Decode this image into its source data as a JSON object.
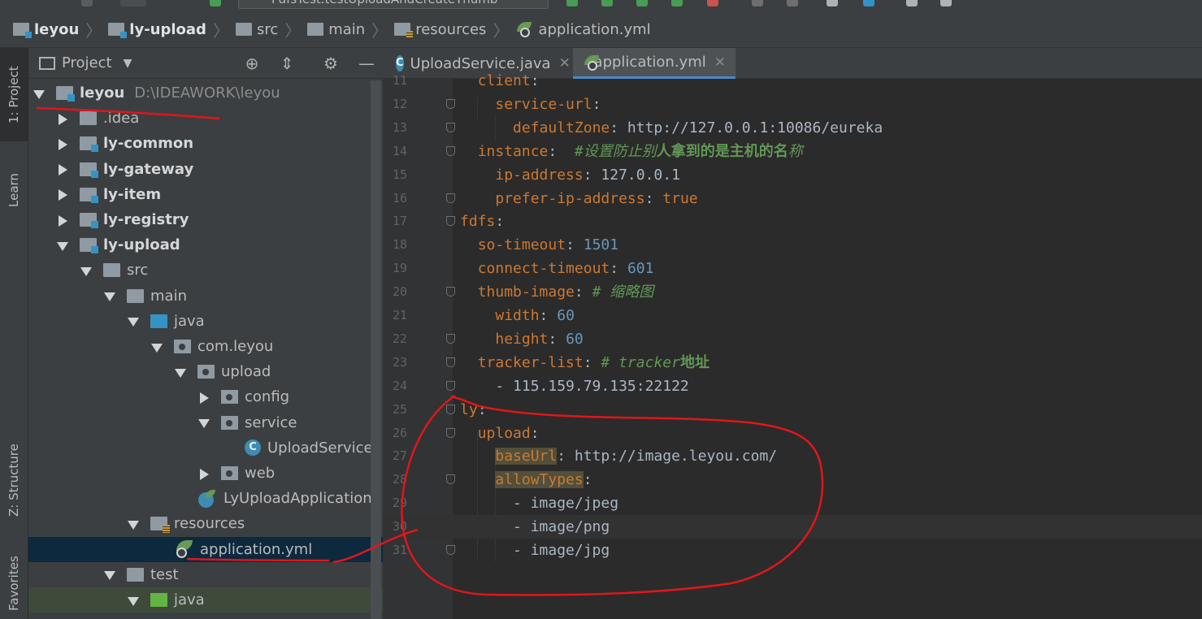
{
  "toolbar": {
    "run_config": "FdfsTest.testUploadAndCreateThumb"
  },
  "breadcrumb": [
    "leyou",
    "ly-upload",
    "src",
    "main",
    "resources",
    "application.yml"
  ],
  "side_stripe": {
    "project": "1: Project",
    "learn": "Learn",
    "structure": "Z: Structure",
    "favorites": "Favorites"
  },
  "project_panel": {
    "title": "Project",
    "tree": [
      {
        "label": "leyou",
        "path": "D:\\IDEAWORK\\leyou",
        "level": 0,
        "expand": "down",
        "icon": "folder-module",
        "bold": true
      },
      {
        "label": ".idea",
        "level": 1,
        "expand": "right",
        "icon": "folder"
      },
      {
        "label": "ly-common",
        "level": 1,
        "expand": "right",
        "icon": "folder-module",
        "bold": true
      },
      {
        "label": "ly-gateway",
        "level": 1,
        "expand": "right",
        "icon": "folder-module",
        "bold": true
      },
      {
        "label": "ly-item",
        "level": 1,
        "expand": "right",
        "icon": "folder-module",
        "bold": true
      },
      {
        "label": "ly-registry",
        "level": 1,
        "expand": "right",
        "icon": "folder-module",
        "bold": true
      },
      {
        "label": "ly-upload",
        "level": 1,
        "expand": "down",
        "icon": "folder-module",
        "bold": true
      },
      {
        "label": "src",
        "level": 2,
        "expand": "down",
        "icon": "folder"
      },
      {
        "label": "main",
        "level": 3,
        "expand": "down",
        "icon": "folder"
      },
      {
        "label": "java",
        "level": 4,
        "expand": "down",
        "icon": "folder-blue"
      },
      {
        "label": "com.leyou",
        "level": 5,
        "expand": "down",
        "icon": "package"
      },
      {
        "label": "upload",
        "level": 6,
        "expand": "down",
        "icon": "package"
      },
      {
        "label": "config",
        "level": 7,
        "expand": "right",
        "icon": "package"
      },
      {
        "label": "service",
        "level": 7,
        "expand": "down",
        "icon": "package"
      },
      {
        "label": "UploadService",
        "level": 8,
        "expand": "none",
        "icon": "class"
      },
      {
        "label": "web",
        "level": 7,
        "expand": "right",
        "icon": "package"
      },
      {
        "label": "LyUploadApplication",
        "level": 6,
        "expand": "none",
        "icon": "spring-class"
      },
      {
        "label": "resources",
        "level": 4,
        "expand": "down",
        "icon": "folder-res"
      },
      {
        "label": "application.yml",
        "level": 5,
        "expand": "none",
        "icon": "spring-yml",
        "selected": true
      },
      {
        "label": "test",
        "level": 3,
        "expand": "down",
        "icon": "folder"
      },
      {
        "label": "java",
        "level": 4,
        "expand": "down",
        "icon": "folder-green",
        "green": true
      }
    ]
  },
  "editor": {
    "tabs": [
      {
        "label": "UploadService.java",
        "icon": "class-icon",
        "active": false
      },
      {
        "label": "application.yml",
        "icon": "spring-yml-icon",
        "active": true
      }
    ],
    "lines": [
      {
        "n": "11",
        "fold": false,
        "segs": [
          [
            "  ",
            ""
          ],
          [
            "client",
            "k"
          ],
          [
            ":",
            "v"
          ]
        ]
      },
      {
        "n": "12",
        "fold": true,
        "segs": [
          [
            "    ",
            ""
          ],
          [
            "service-url",
            "k"
          ],
          [
            ":",
            "v"
          ]
        ]
      },
      {
        "n": "13",
        "fold": true,
        "segs": [
          [
            "      ",
            ""
          ],
          [
            "defaultZone",
            "k"
          ],
          [
            ": http://127.0.0.1:10086/eureka",
            "v"
          ]
        ]
      },
      {
        "n": "14",
        "fold": true,
        "segs": [
          [
            "  ",
            ""
          ],
          [
            "instance",
            "k"
          ],
          [
            ":  ",
            "v"
          ],
          [
            "#设置防止",
            "cm"
          ],
          [
            "别",
            "cm"
          ],
          [
            "人拿到的是主机的名",
            "cmb"
          ],
          [
            "称",
            "cm"
          ]
        ]
      },
      {
        "n": "15",
        "fold": false,
        "segs": [
          [
            "    ",
            ""
          ],
          [
            "ip-address",
            "k"
          ],
          [
            ": 127.0.0.1",
            "v"
          ]
        ]
      },
      {
        "n": "16",
        "fold": true,
        "segs": [
          [
            "    ",
            ""
          ],
          [
            "prefer-ip-address",
            "k"
          ],
          [
            ": ",
            "v"
          ],
          [
            "true",
            "k"
          ]
        ]
      },
      {
        "n": "17",
        "fold": true,
        "segs": [
          [
            "fdfs",
            "k"
          ],
          [
            ":",
            "v"
          ]
        ]
      },
      {
        "n": "18",
        "fold": false,
        "segs": [
          [
            "  ",
            ""
          ],
          [
            "so-timeout",
            "k"
          ],
          [
            ": ",
            "v"
          ],
          [
            "1501",
            "n"
          ]
        ]
      },
      {
        "n": "19",
        "fold": false,
        "segs": [
          [
            "  ",
            ""
          ],
          [
            "connect-timeout",
            "k"
          ],
          [
            ": ",
            "v"
          ],
          [
            "601",
            "n"
          ]
        ]
      },
      {
        "n": "20",
        "fold": true,
        "segs": [
          [
            "  ",
            ""
          ],
          [
            "thumb-image",
            "k"
          ],
          [
            ": ",
            "v"
          ],
          [
            "# 缩略图",
            "cm"
          ]
        ]
      },
      {
        "n": "21",
        "fold": false,
        "segs": [
          [
            "    ",
            ""
          ],
          [
            "width",
            "k"
          ],
          [
            ": ",
            "v"
          ],
          [
            "60",
            "n"
          ]
        ]
      },
      {
        "n": "22",
        "fold": true,
        "segs": [
          [
            "    ",
            ""
          ],
          [
            "height",
            "k"
          ],
          [
            ": ",
            "v"
          ],
          [
            "60",
            "n"
          ]
        ]
      },
      {
        "n": "23",
        "fold": true,
        "segs": [
          [
            "  ",
            ""
          ],
          [
            "tracker-list",
            "k"
          ],
          [
            ": ",
            "v"
          ],
          [
            "# tracker",
            "cm"
          ],
          [
            "地址",
            "cmb"
          ]
        ]
      },
      {
        "n": "24",
        "fold": true,
        "segs": [
          [
            "    - 115.159.79.135:22122",
            "v"
          ]
        ]
      },
      {
        "n": "25",
        "fold": true,
        "segs": [
          [
            "ly",
            "k"
          ],
          [
            ":",
            "v"
          ]
        ]
      },
      {
        "n": "26",
        "fold": true,
        "segs": [
          [
            "  ",
            ""
          ],
          [
            "upload",
            "k"
          ],
          [
            ":",
            "v"
          ]
        ]
      },
      {
        "n": "27",
        "fold": false,
        "segs": [
          [
            "    ",
            ""
          ],
          [
            "baseUrl",
            "k hl"
          ],
          [
            ": http://image.leyou.com/",
            "v"
          ]
        ]
      },
      {
        "n": "28",
        "fold": true,
        "segs": [
          [
            "    ",
            ""
          ],
          [
            "allowTypes",
            "k hl"
          ],
          [
            ":",
            "v"
          ]
        ]
      },
      {
        "n": "29",
        "fold": false,
        "segs": [
          [
            "      - image/jpeg",
            "v"
          ]
        ]
      },
      {
        "n": "30",
        "fold": false,
        "current": true,
        "segs": [
          [
            "      - image/png",
            "v"
          ]
        ]
      },
      {
        "n": "31",
        "fold": true,
        "segs": [
          [
            "      - image/jpg",
            "v"
          ]
        ]
      }
    ]
  },
  "colors": {
    "keyword": "#cc7832",
    "number": "#6897bb",
    "comment": "#629755",
    "annotation": "#e0161b",
    "selection": "#0d293e"
  }
}
